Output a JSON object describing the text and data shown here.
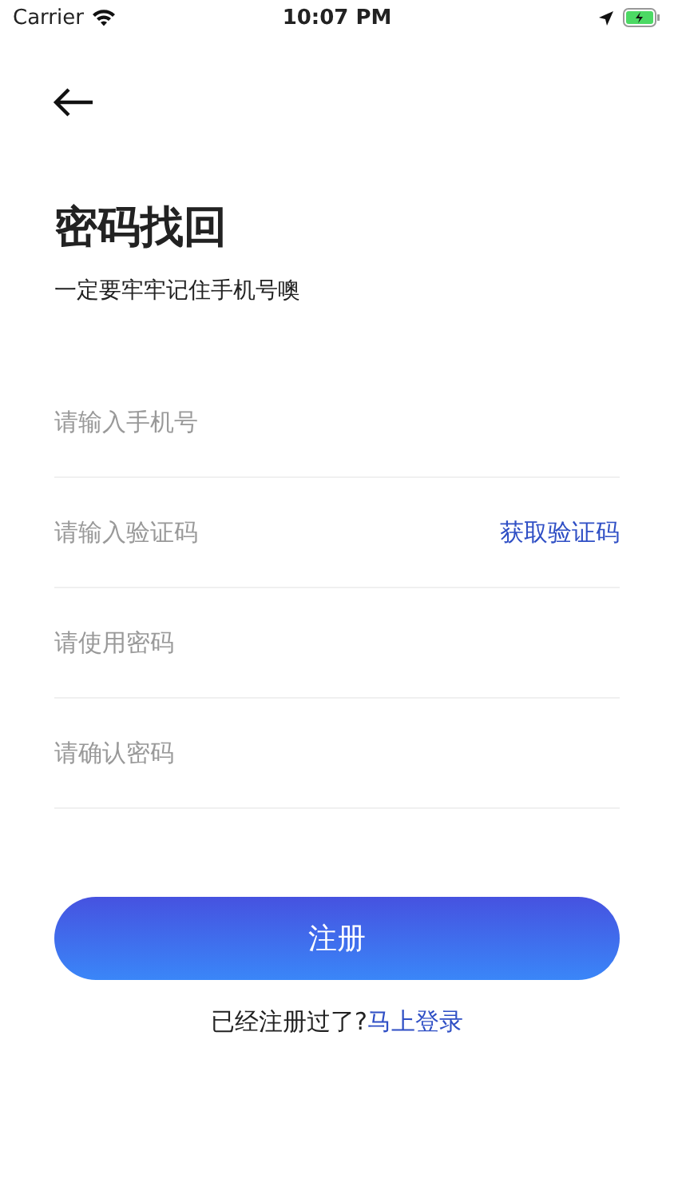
{
  "status_bar": {
    "carrier": "Carrier",
    "time": "10:07 PM"
  },
  "title": "密码找回",
  "subtitle": "一定要牢牢记住手机号噢",
  "fields": [
    {
      "kind": "plain",
      "placeholder": "请输入手机号"
    },
    {
      "kind": "code",
      "placeholder": "请输入验证码",
      "action": "获取验证码"
    },
    {
      "kind": "plain",
      "placeholder": "请使用密码"
    },
    {
      "kind": "plain",
      "placeholder": "请确认密码"
    }
  ],
  "submit": "注册",
  "footer": {
    "text": "已经注册过了?",
    "link": "马上登录"
  }
}
